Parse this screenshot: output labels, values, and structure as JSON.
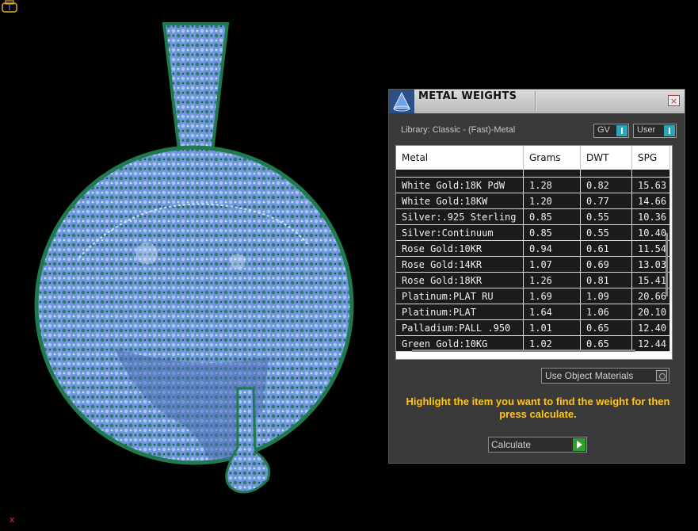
{
  "panel": {
    "title": "METAL WEIGHTS",
    "close_glyph": "×",
    "library_label": "Library: Classic - (Fast)-Metal",
    "toggles": [
      {
        "label": "GV"
      },
      {
        "label": "User"
      }
    ],
    "table": {
      "headers": [
        "Metal",
        "Grams",
        "DWT",
        "SPG"
      ],
      "rows": [
        [
          "White Gold:18K PdW",
          "1.28",
          "0.82",
          "15.63"
        ],
        [
          "White Gold:18KW",
          "1.20",
          "0.77",
          "14.66"
        ],
        [
          "Silver:.925 Sterling",
          "0.85",
          "0.55",
          "10.36"
        ],
        [
          "Silver:Continuum",
          "0.85",
          "0.55",
          "10.40"
        ],
        [
          "Rose Gold:10KR",
          "0.94",
          "0.61",
          "11.54"
        ],
        [
          "Rose Gold:14KR",
          "1.07",
          "0.69",
          "13.03"
        ],
        [
          "Rose Gold:18KR",
          "1.26",
          "0.81",
          "15.41"
        ],
        [
          "Platinum:PLAT RU",
          "1.69",
          "1.09",
          "20.66"
        ],
        [
          "Platinum:PLAT",
          "1.64",
          "1.06",
          "20.10"
        ],
        [
          "Palladium:PALL .950",
          "1.01",
          "0.65",
          "12.40"
        ],
        [
          "Green Gold:10KG",
          "1.02",
          "0.65",
          "12.44"
        ]
      ]
    },
    "use_object_materials": "Use Object Materials",
    "instruction": "Highlight the item you want to find the weight for then press calculate.",
    "calculate_label": "Calculate"
  },
  "viewport": {
    "axis_label": "x"
  },
  "colors": {
    "accent_teal": "#2aa6b8",
    "instruction_yellow": "#ffc61a",
    "model_blue": "#6f97dd",
    "gem_green": "#1f7a4e",
    "go_green": "#2f9e2f"
  },
  "icons": {
    "logo": "cone-logo-icon",
    "close": "close-icon",
    "calculate": "play-arrow-icon",
    "corner": "camera-view-icon"
  }
}
